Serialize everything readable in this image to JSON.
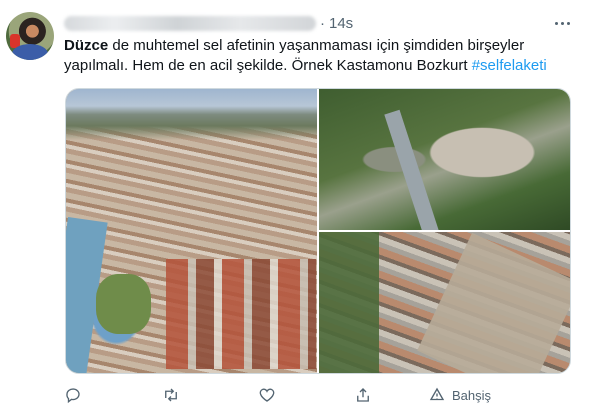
{
  "tweet": {
    "timestamp": "14s",
    "separator": "·",
    "text": {
      "bold_lead": "Düzce",
      "body": " de muhtemel sel afetinin yaşanmaması için şimdiden birşeyler yapılmalı. Hem de en acil şekilde. Örnek Kastamonu Bozkurt ",
      "hashtag": "#selfelaketi"
    }
  },
  "actions": {
    "tip_label": "Bahşiş"
  },
  "icons": {
    "more": "more-horizontal-icon",
    "reply": "reply-icon",
    "retweet": "retweet-icon",
    "like": "heart-icon",
    "share": "share-icon",
    "tip": "tip-icon"
  },
  "colors": {
    "accent": "#1d9bf0",
    "text_secondary": "#536471",
    "text_primary": "#0f1419"
  }
}
